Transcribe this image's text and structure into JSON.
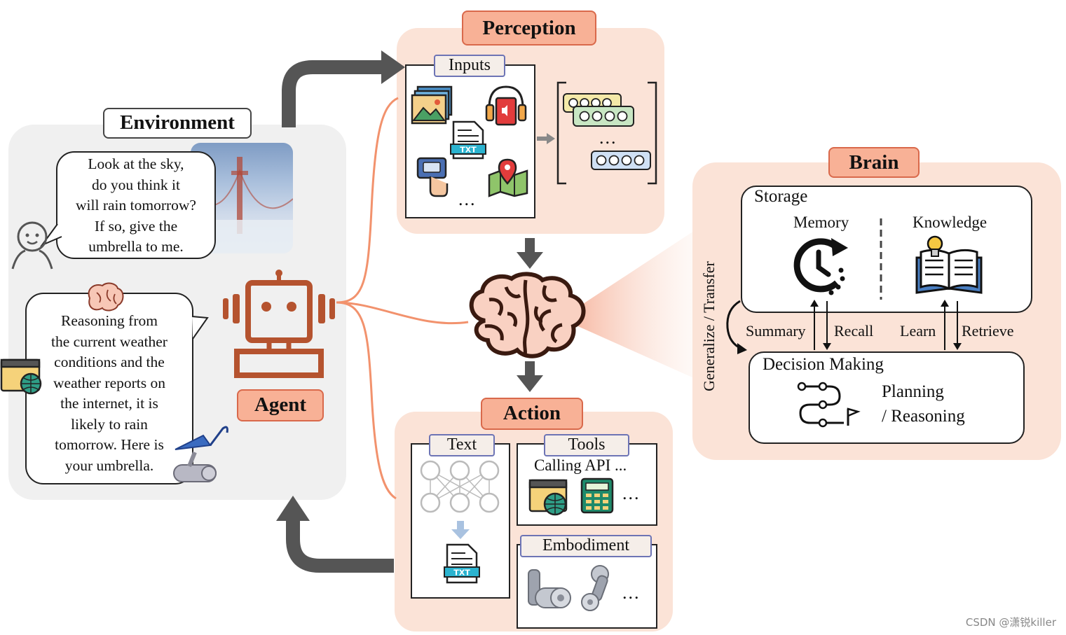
{
  "diagram": {
    "sections": {
      "environment": {
        "title": "Environment",
        "user_speech": [
          "Look at the sky,",
          "do you think it",
          "will rain tomorrow?",
          "If so, give the",
          "umbrella to me."
        ],
        "agent_speech": [
          "Reasoning from",
          "the current weather",
          "conditions and the",
          "weather reports on",
          "the internet, it is",
          "likely to rain",
          "tomorrow. Here is",
          "your umbrella."
        ]
      },
      "agent": {
        "label": "Agent"
      },
      "perception": {
        "title": "Perception",
        "inputs_label": "Inputs",
        "inputs_ellipsis": "...",
        "tokens_ellipsis": "...",
        "input_icons": [
          "image-gallery-icon",
          "headphones-audio-icon",
          "txt-file-icon",
          "fingerprint-touch-icon",
          "map-location-icon"
        ]
      },
      "brain": {
        "title": "Brain",
        "storage_label": "Storage",
        "memory_label": "Memory",
        "knowledge_label": "Knowledge",
        "decision_label": "Decision Making",
        "planning_label_1": "Planning",
        "planning_label_2": "/ Reasoning",
        "generalize_label": "Generalize / Transfer",
        "flows": {
          "summary": "Summary",
          "recall": "Recall",
          "learn": "Learn",
          "retrieve": "Retrieve"
        }
      },
      "action": {
        "title": "Action",
        "text_label": "Text",
        "tools_label": "Tools",
        "tools_caption": "Calling API ...",
        "tools_ellipsis": "...",
        "embodiment_label": "Embodiment",
        "embodiment_ellipsis": "..."
      }
    },
    "colors": {
      "title_fill": "#f8b196",
      "title_border": "#d9694b",
      "panel_peach": "#fbe3d7",
      "panel_gray": "#f0f0f0",
      "agent_brown": "#b5532f",
      "connector_orange": "#f2926d",
      "arrow_gray": "#555555",
      "tab_border": "#6d74b5"
    },
    "watermark": "CSDN @潇锐killer"
  }
}
